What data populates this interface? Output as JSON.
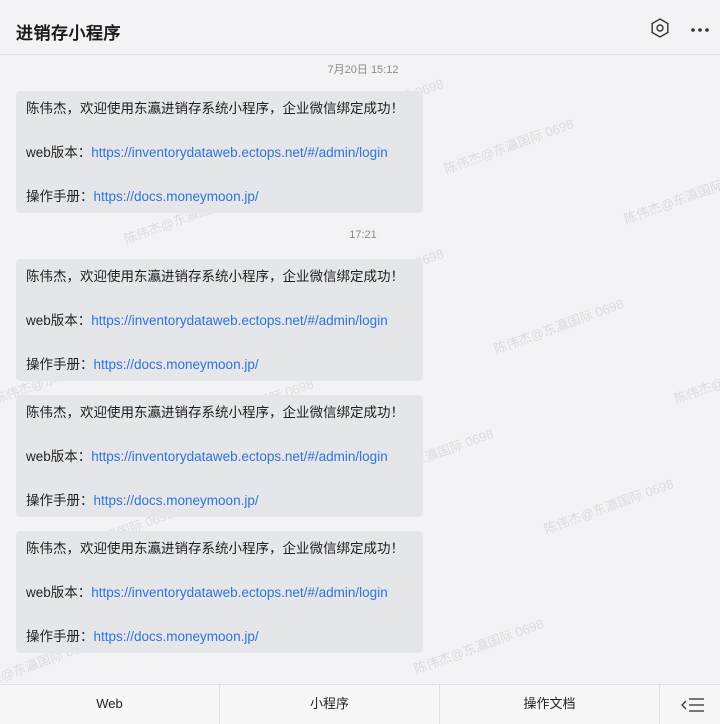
{
  "header": {
    "title": "进销存小程序"
  },
  "watermark_text": "陈伟杰@东瀛国际 0698",
  "messages": [
    {
      "timestamp": "7月20日 15:12",
      "greeting": "陈伟杰，欢迎使用东瀛进销存系统小程序，企业微信绑定成功！",
      "web_label": "web版本：",
      "web_url": "https://inventorydataweb.ectops.net/#/admin/login",
      "manual_label": "操作手册：",
      "manual_url": "https://docs.moneymoon.jp/"
    },
    {
      "timestamp": "17:21",
      "greeting": "陈伟杰，欢迎使用东瀛进销存系统小程序，企业微信绑定成功！",
      "web_label": "web版本：",
      "web_url": "https://inventorydataweb.ectops.net/#/admin/login",
      "manual_label": "操作手册：",
      "manual_url": "https://docs.moneymoon.jp/"
    },
    {
      "greeting": "陈伟杰，欢迎使用东瀛进销存系统小程序，企业微信绑定成功！",
      "web_label": "web版本：",
      "web_url": "https://inventorydataweb.ectops.net/#/admin/login",
      "manual_label": "操作手册：",
      "manual_url": "https://docs.moneymoon.jp/"
    },
    {
      "greeting": "陈伟杰，欢迎使用东瀛进销存系统小程序，企业微信绑定成功！",
      "web_label": "web版本：",
      "web_url": "https://inventorydataweb.ectops.net/#/admin/login",
      "manual_label": "操作手册：",
      "manual_url": "https://docs.moneymoon.jp/"
    }
  ],
  "bottom_menu": {
    "tabs": [
      "Web",
      "小程序",
      "操作文档"
    ]
  },
  "icons": {
    "settings": "settings-icon",
    "more": "more-icon",
    "menu_toggle": "menu-toggle-icon"
  },
  "colors": {
    "link": "#3173d6",
    "bubble": "#e5e6ea",
    "background": "#f3f3f5"
  }
}
